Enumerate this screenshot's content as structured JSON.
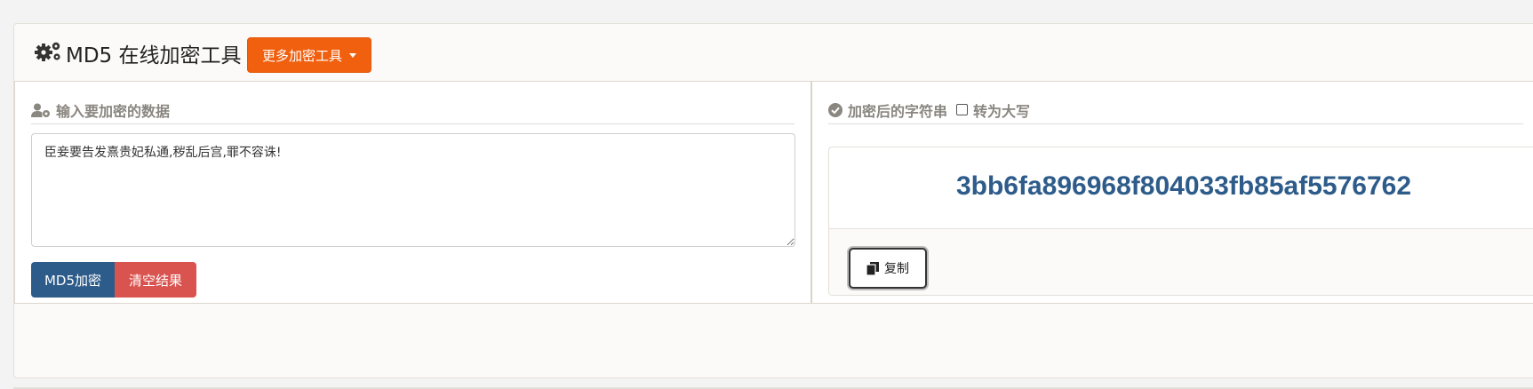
{
  "header": {
    "title": "MD5 在线加密工具",
    "more_tools_label": "更多加密工具"
  },
  "input_section": {
    "title": "输入要加密的数据",
    "input_value": "臣妾要告发熹贵妃私通,秽乱后宫,罪不容诛!",
    "encrypt_button": "MD5加密",
    "clear_button": "清空结果"
  },
  "result_section": {
    "title": "加密后的字符串",
    "uppercase_label": "转为大写",
    "uppercase_checked": false,
    "hash_value": "3bb6fa896968f804033fb85af5576762",
    "copy_button": "复制"
  },
  "icons": {
    "title_icon": "gears-icon",
    "input_icon": "user-gear-icon",
    "result_icon": "check-circle-icon",
    "copy_icon": "copy-icon"
  },
  "colors": {
    "accent_orange": "#f0600f",
    "primary_blue": "#2e5c8a",
    "danger_red": "#d9534f"
  }
}
